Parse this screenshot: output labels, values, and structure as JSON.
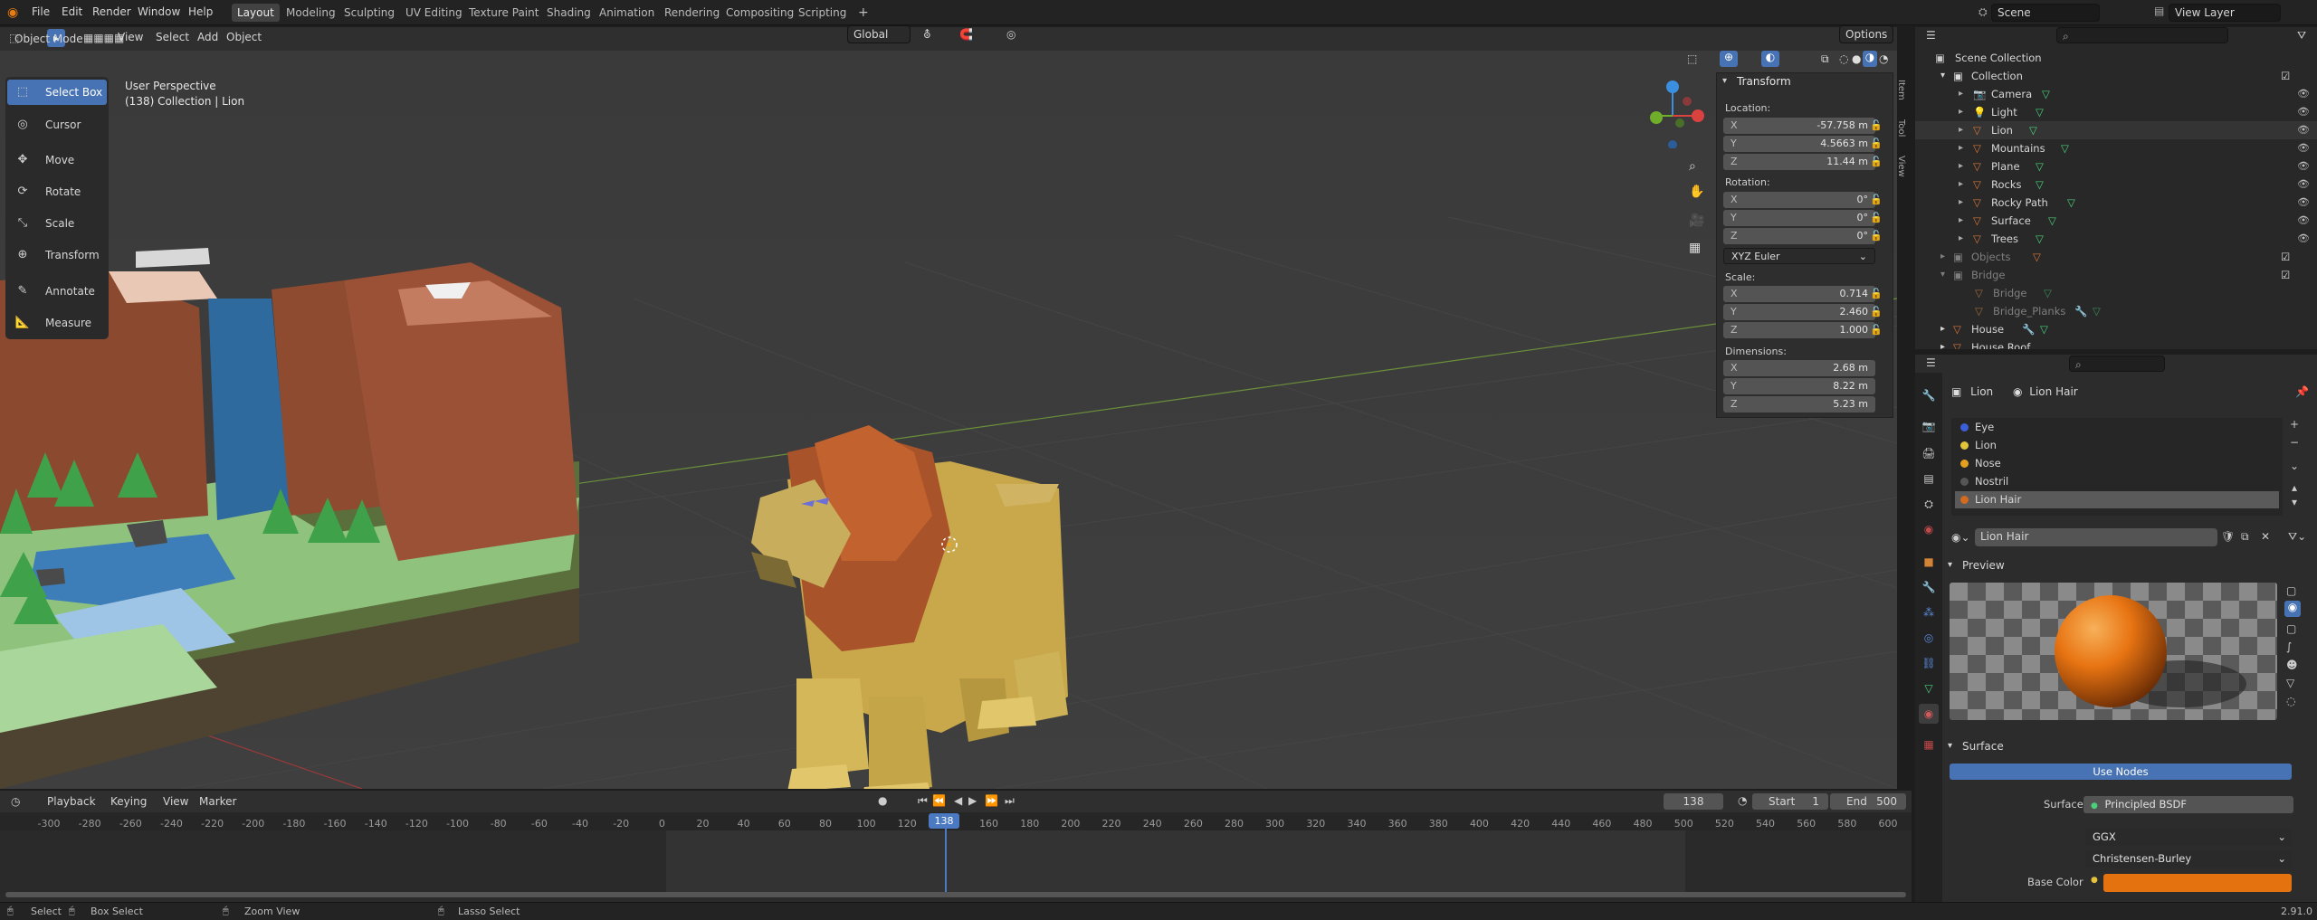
{
  "topbar": {
    "menus": [
      "File",
      "Edit",
      "Render",
      "Window",
      "Help"
    ],
    "workspaces": [
      "Layout",
      "Modeling",
      "Sculpting",
      "UV Editing",
      "Texture Paint",
      "Shading",
      "Animation",
      "Rendering",
      "Compositing",
      "Scripting"
    ],
    "active_workspace": "Layout",
    "add_tab": "+",
    "scene": "Scene",
    "view_layer": "View Layer"
  },
  "viewport_header": {
    "mode": "Object Mode",
    "menus": [
      "View",
      "Select",
      "Add",
      "Object"
    ],
    "transform_orientation": "Global",
    "options": "Options"
  },
  "viewport": {
    "perspective": "User Perspective",
    "collection_info": "(138) Collection | Lion"
  },
  "tools": [
    "Select Box",
    "Cursor",
    "Move",
    "Rotate",
    "Scale",
    "Transform",
    "Annotate",
    "Measure"
  ],
  "npanel": {
    "title": "Transform",
    "location_label": "Location:",
    "location": {
      "x": "-57.758 m",
      "y": "4.5663 m",
      "z": "11.44 m"
    },
    "rotation_label": "Rotation:",
    "rotation": {
      "x": "0°",
      "y": "0°",
      "z": "0°"
    },
    "rotation_mode": "XYZ Euler",
    "scale_label": "Scale:",
    "scale": {
      "x": "0.714",
      "y": "2.460",
      "z": "1.000"
    },
    "dimensions_label": "Dimensions:",
    "dimensions": {
      "x": "2.68 m",
      "y": "8.22 m",
      "z": "5.23 m"
    },
    "axes": [
      "X",
      "Y",
      "Z"
    ],
    "side_tabs": [
      "Item",
      "Tool",
      "View"
    ]
  },
  "timeline": {
    "menus": [
      "Playback",
      "Keying",
      "View",
      "Marker"
    ],
    "current_frame": "138",
    "start_label": "Start",
    "start": "1",
    "end_label": "End",
    "end": "500",
    "ticks": [
      "-300",
      "-280",
      "-260",
      "-240",
      "-220",
      "-200",
      "-180",
      "-160",
      "-140",
      "-120",
      "-100",
      "-80",
      "-60",
      "-40",
      "-20",
      "0",
      "20",
      "40",
      "60",
      "80",
      "100",
      "120",
      "138",
      "160",
      "180",
      "200",
      "220",
      "240",
      "260",
      "280",
      "300",
      "320",
      "340",
      "360",
      "380",
      "400",
      "420",
      "440",
      "460",
      "480",
      "500",
      "520",
      "540",
      "560",
      "580",
      "600"
    ]
  },
  "status": {
    "select": "Select",
    "box_select": "Box Select",
    "zoom_view": "Zoom View",
    "lasso_select": "Lasso Select",
    "version": "2.91.0"
  },
  "outliner": {
    "root": "Scene Collection",
    "collection": "Collection",
    "items": [
      "Camera",
      "Light",
      "Lion",
      "Mountains",
      "Plane",
      "Rocks",
      "Rocky Path",
      "Surface",
      "Trees"
    ],
    "objects": "Objects",
    "bridge_collection": "Bridge",
    "bridge_items": [
      "Bridge",
      "Bridge_Planks"
    ],
    "more_items": [
      "House",
      "House Roof"
    ]
  },
  "properties": {
    "object_name": "Lion",
    "material_name": "Lion Hair",
    "slots": [
      "Eye",
      "Lion",
      "Nose",
      "Nostril",
      "Lion Hair"
    ],
    "slot_colors": [
      "#3a5fd8",
      "#e2c53a",
      "#e3a020",
      "#555555",
      "#d26a1f"
    ],
    "material_field": "Lion Hair",
    "preview_label": "Preview",
    "surface_label": "Surface",
    "use_nodes": "Use Nodes",
    "surface_field_label": "Surface",
    "surface_value": "Principled BSDF",
    "distribution": "GGX",
    "subsurface_method": "Christensen-Burley",
    "base_color_label": "Base Color",
    "base_color": "#e3720f"
  }
}
